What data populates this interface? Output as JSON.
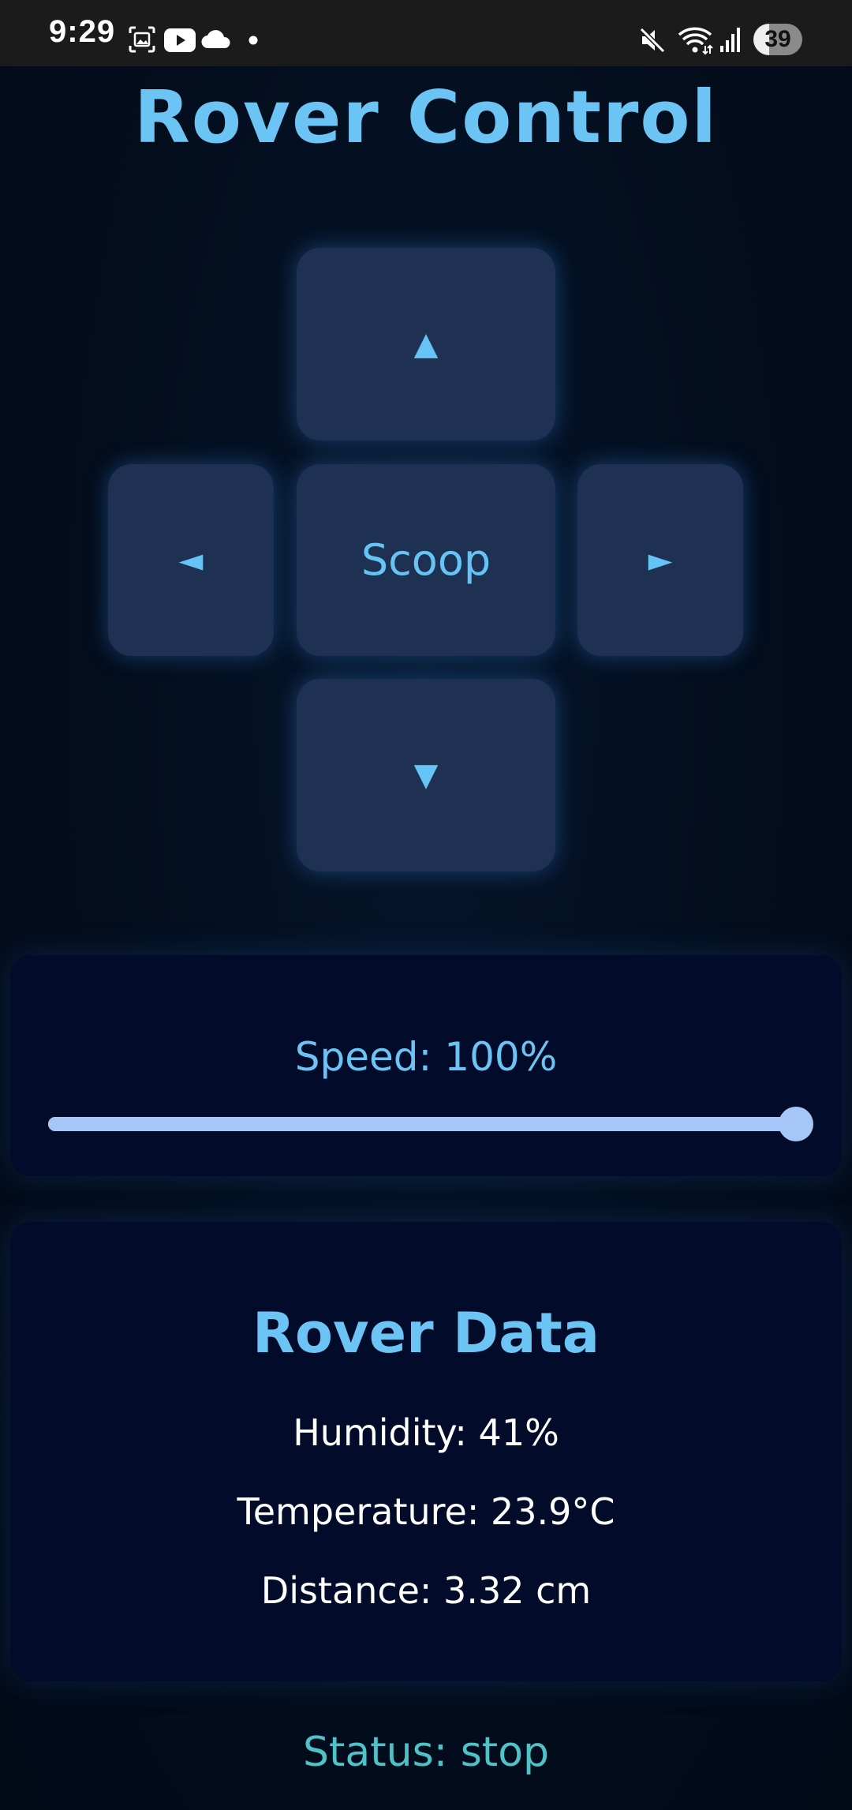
{
  "status_bar": {
    "time": "9:29",
    "battery": "39",
    "icons": [
      "screenshot-icon",
      "youtube-icon",
      "cloud-icon",
      "notification-dot-icon",
      "mute-icon",
      "wifi-icon",
      "signal-icon",
      "battery-icon"
    ]
  },
  "app": {
    "title": "Rover Control",
    "accent_color": "#6cc4f5",
    "background_color": "#020c1c"
  },
  "controls": {
    "up": "▲",
    "left": "◄",
    "center": "Scoop",
    "right": "►",
    "down": "▼"
  },
  "speed": {
    "label": "Speed: 100%",
    "value_percent": 100
  },
  "rover_data": {
    "title": "Rover Data",
    "humidity": "Humidity: 41%",
    "temperature": "Temperature: 23.9°C",
    "distance": "Distance: 3.32 cm"
  },
  "status": {
    "text": "Status: stop",
    "color": "#4fc2c8"
  }
}
